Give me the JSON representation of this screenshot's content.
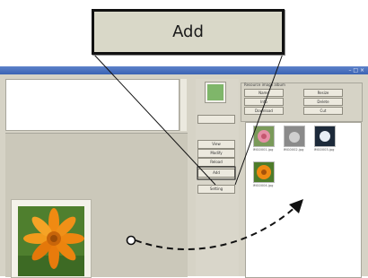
{
  "callout": {
    "label": "Add"
  },
  "window": {
    "controls": "– □ ×"
  },
  "sidebar": {
    "buttons": [
      "",
      "View",
      "Modify",
      "Reload",
      "Add",
      "Setting"
    ]
  },
  "right_panel": {
    "title": "Resource image album",
    "buttons": [
      "Name",
      "Resize",
      "Info",
      "Delete",
      "Download",
      "Cut"
    ]
  },
  "gallery": {
    "captions": [
      "IMG0001.jpg",
      "IMG0002.jpg",
      "IMG0003.jpg",
      "IMG0004.jpg"
    ]
  },
  "colors": {
    "accent_title": "#3a63b4",
    "callout_bg": "#d9d8c8"
  }
}
